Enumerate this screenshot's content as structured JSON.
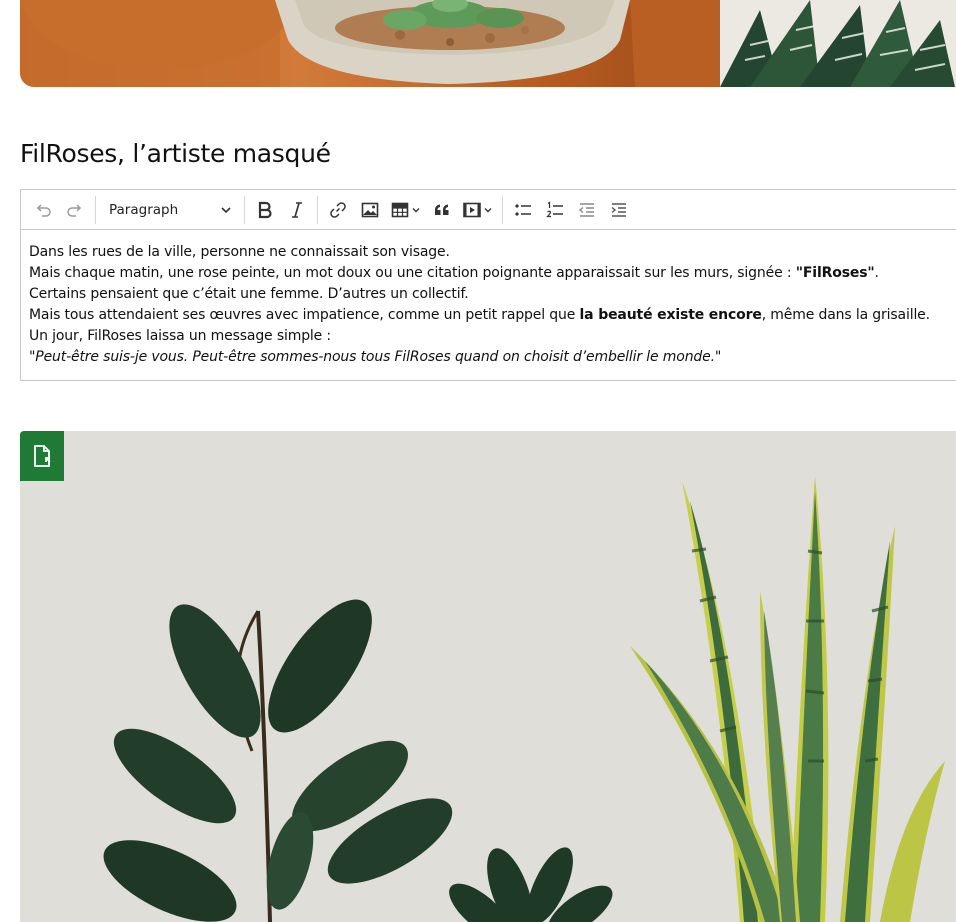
{
  "hero_image": {
    "alt": "",
    "icon": "succulent-pots-image"
  },
  "section": {
    "title": "FilRoses, l’artiste masqué"
  },
  "editor": {
    "toolbar": {
      "heading_select_value": "Paragraph",
      "icons": [
        "undo-icon",
        "redo-icon",
        "bold-icon",
        "italic-icon",
        "link-icon",
        "image-icon",
        "table-icon",
        "blockquote-icon",
        "media-icon",
        "bulleted-list-icon",
        "numbered-list-icon",
        "outdent-icon",
        "indent-icon"
      ]
    },
    "content": {
      "line1": "Dans les rues de la ville, personne ne connaissait son visage.",
      "line2_before": "Mais chaque matin, une rose peinte, un mot doux ou une citation poignante apparaissait sur les murs, signée : ",
      "line2_bold": "\"FilRoses\"",
      "line2_after": ".",
      "line3": "Certains pensaient que c’était une femme. D’autres un collectif.",
      "line4_before": "Mais tous attendaient ses œuvres avec impatience, comme un petit rappel que ",
      "line4_bold": "la beauté existe encore",
      "line4_after": ", même dans la grisaille.",
      "line5": "Un jour, FilRoses laissa un message simple :",
      "line6_italic": "\"Peut-être suis-je vous. Peut-être sommes-nous tous FilRoses quand on choisit d’embellir le monde.\""
    }
  },
  "colors": {
    "badge": "#1f7a35",
    "border": "#c8c8c8"
  },
  "plant_image": {
    "icon": "house-plants-image"
  },
  "file_badge": {
    "icon": "file-replace-icon"
  }
}
